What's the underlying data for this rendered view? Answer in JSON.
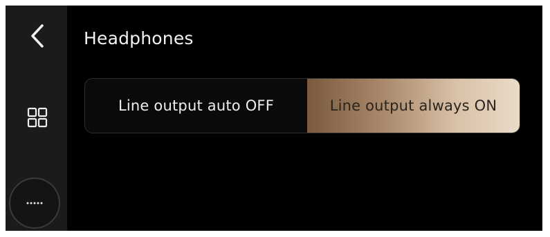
{
  "header": {
    "title": "Headphones"
  },
  "sidebar": {
    "back_icon": "chevron-left-icon",
    "grid_icon": "grid-icon",
    "more_icon": "dots-icon"
  },
  "line_output": {
    "options": [
      {
        "label": "Line output auto OFF",
        "selected": false
      },
      {
        "label": "Line output always ON",
        "selected": true
      }
    ]
  },
  "colors": {
    "background": "#000000",
    "rail": "#1b1b1b",
    "selected_gradient_start": "#7a5a3e",
    "selected_gradient_end": "#eadbc9",
    "text": "#eeeeee"
  }
}
